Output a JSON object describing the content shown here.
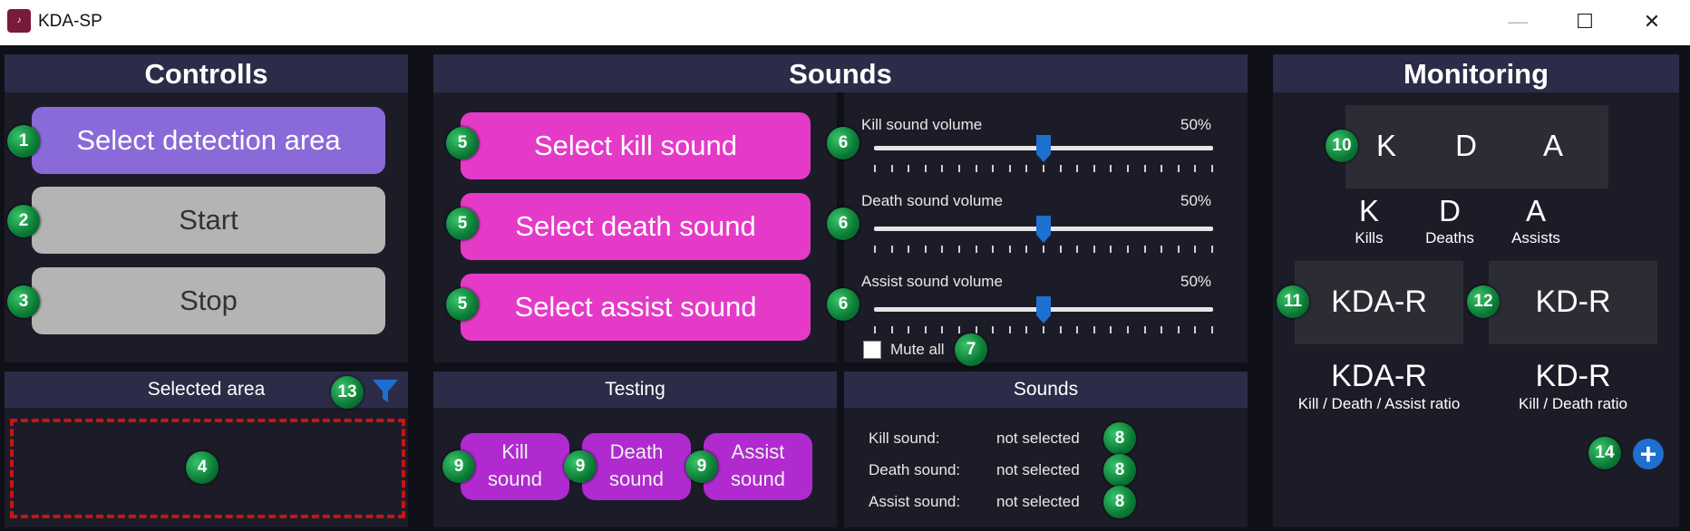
{
  "window": {
    "title": "KDA-SP",
    "icon_name": "app-logo-icon",
    "minimize": "—",
    "maximize": "☐",
    "close": "✕"
  },
  "controls": {
    "header": "Controlls",
    "select_area": "Select detection area",
    "start": "Start",
    "stop": "Stop"
  },
  "selected_area": {
    "header": "Selected area",
    "filter_icon": "filter-icon"
  },
  "sounds": {
    "header": "Sounds",
    "kill_btn": "Select kill sound",
    "death_btn": "Select death sound",
    "assist_btn": "Select assist sound",
    "kill_volume_label": "Kill sound volume",
    "kill_volume_value": "50%",
    "death_volume_label": "Death sound volume",
    "death_volume_value": "50%",
    "assist_volume_label": "Assist sound volume",
    "assist_volume_value": "50%",
    "volumes": {
      "kill": 0.5,
      "death": 0.5,
      "assist": 0.5
    },
    "mute_all": "Mute all"
  },
  "testing": {
    "header": "Testing",
    "kill": [
      "Kill",
      "sound"
    ],
    "death": [
      "Death",
      "sound"
    ],
    "assist": [
      "Assist",
      "sound"
    ]
  },
  "sounds_status": {
    "header": "Sounds",
    "kill_label": "Kill sound:",
    "kill_value": "not selected",
    "death_label": "Death sound:",
    "death_value": "not selected",
    "assist_label": "Assist sound:",
    "assist_value": "not selected"
  },
  "monitoring": {
    "header": "Monitoring",
    "tile_k": "K",
    "tile_d": "D",
    "tile_a": "A",
    "k": "K",
    "d": "D",
    "a": "A",
    "kills": "Kills",
    "deaths": "Deaths",
    "assists": "Assists",
    "kdar_tile": "KDA-R",
    "kdr_tile": "KD-R",
    "kdar": "KDA-R",
    "kdr": "KD-R",
    "kdar_caption": "Kill / Death / Assist ratio",
    "kdr_caption": "Kill / Death ratio"
  },
  "badges": [
    "1",
    "2",
    "3",
    "4",
    "5",
    "5",
    "5",
    "6",
    "6",
    "6",
    "7",
    "8",
    "8",
    "8",
    "9",
    "9",
    "9",
    "10",
    "11",
    "12",
    "13",
    "14"
  ],
  "colors": {
    "accent_blue": "#1e6fd0",
    "pink": "#e53ac8",
    "purple": "#8a6ad8",
    "badge_green": "#0a7a35"
  }
}
